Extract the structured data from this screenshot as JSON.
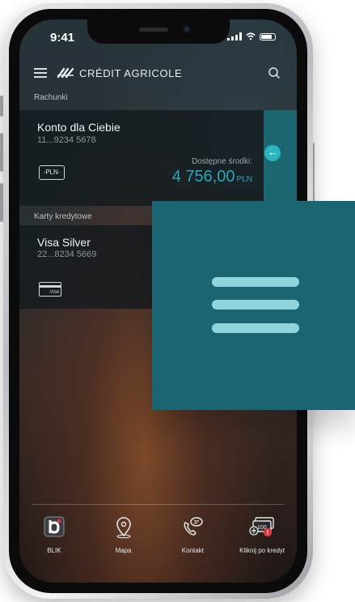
{
  "status_bar": {
    "time": "9:41"
  },
  "header": {
    "brand": "CRÉDIT AGRICOLE"
  },
  "accounts": {
    "section_label": "Rachunki",
    "items": [
      {
        "name": "Konto dla Ciebie",
        "number": "11...9234 5678",
        "currency_badge": "PLN",
        "available_label": "Dostępne środki:",
        "available_amount": "4 756,00",
        "available_currency": "PLN"
      }
    ]
  },
  "credit_cards": {
    "section_label": "Karty kredytowe",
    "items": [
      {
        "name": "Visa Silver",
        "number": "22...8234 5669",
        "card_brand_text": "VISA"
      }
    ]
  },
  "bottom_nav": {
    "items": [
      {
        "label": "BLIK",
        "icon": "blik-icon"
      },
      {
        "label": "Mapa",
        "icon": "map-pin-icon"
      },
      {
        "label": "Kontakt",
        "icon": "phone-chat-icon"
      },
      {
        "label": "Kliknij po kredyt",
        "icon": "money-plus-icon",
        "badge": "!",
        "amount_text": "100"
      }
    ]
  },
  "overlay": {
    "icon": "hamburger-menu-icon"
  },
  "colors": {
    "accent": "#27a9b5",
    "overlay_bg": "#1b6572",
    "overlay_bars": "#8fd3dc"
  }
}
